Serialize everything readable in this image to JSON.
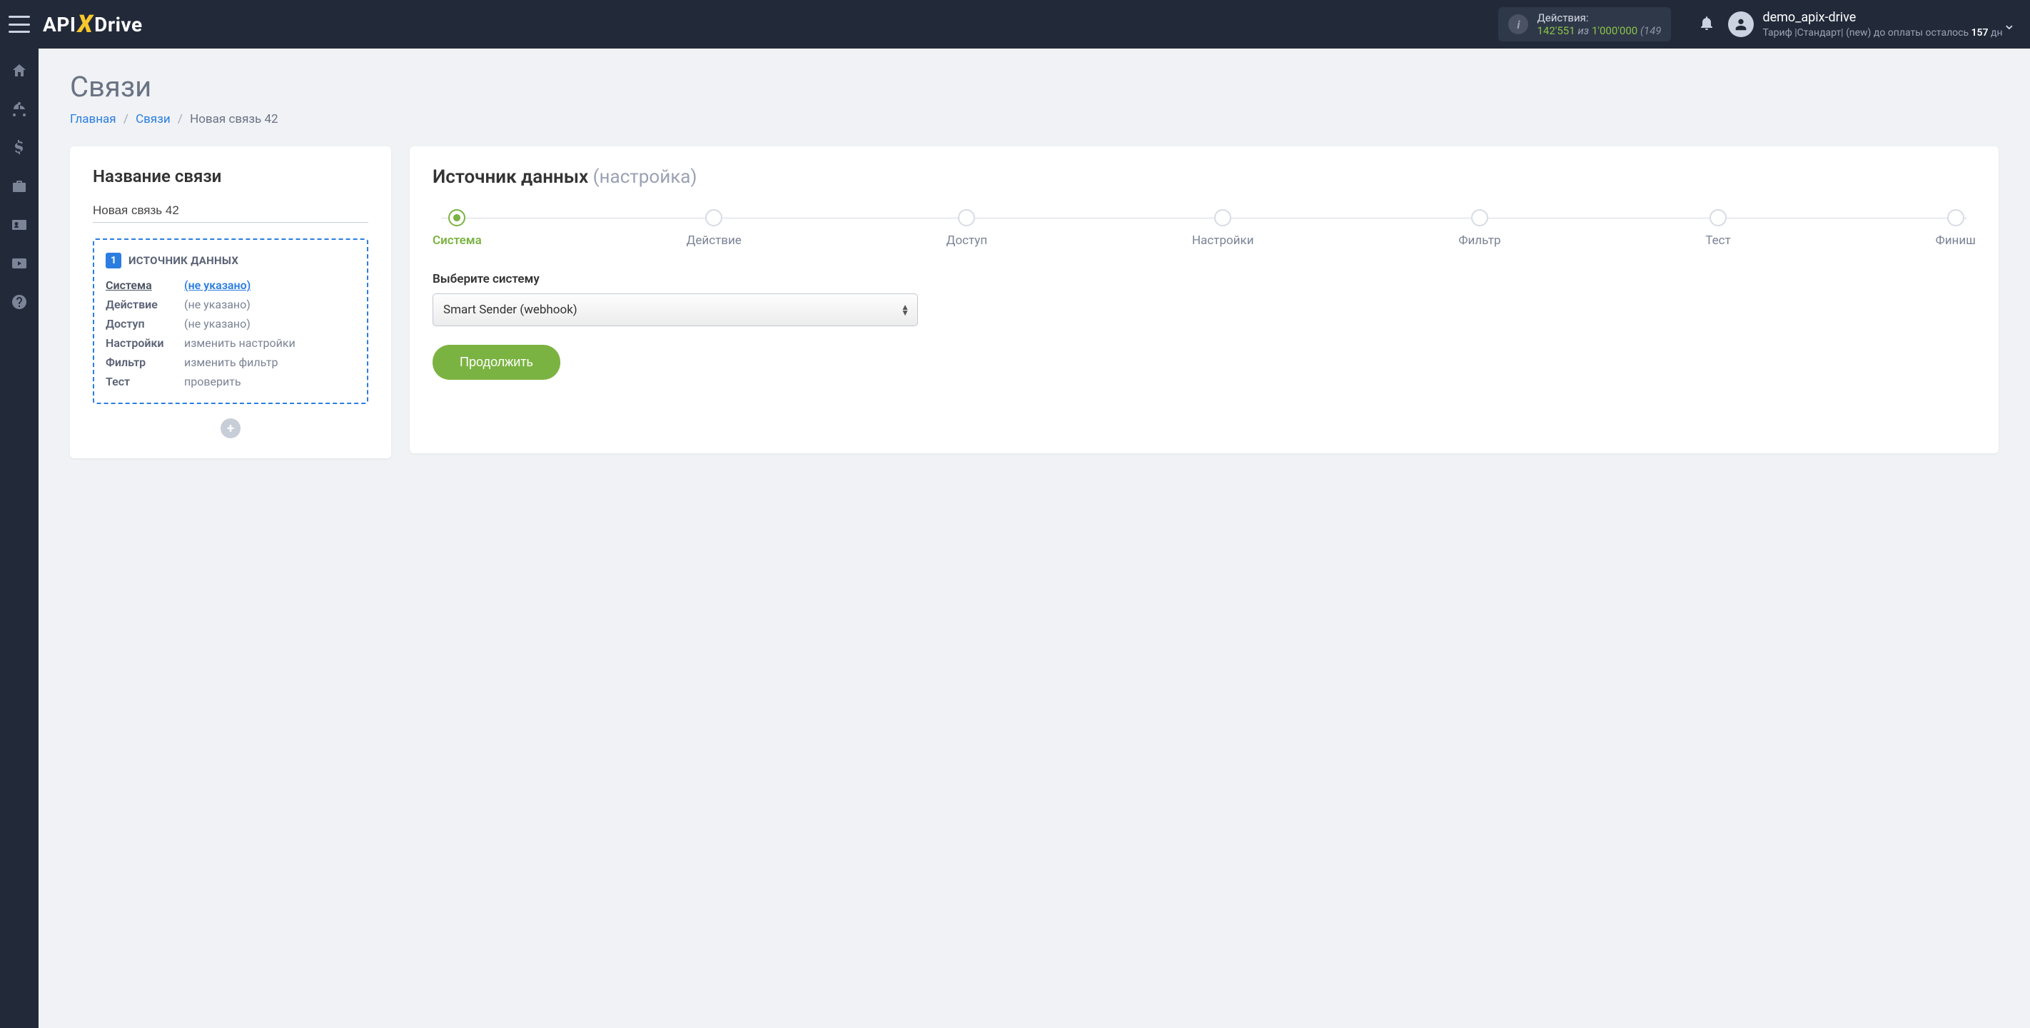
{
  "topbar": {
    "actions_label": "Действия:",
    "actions_count": "142'551",
    "actions_of": "из",
    "actions_total": "1'000'000",
    "actions_extra": "(149",
    "username": "demo_apix-drive",
    "tariff_prefix": "Тариф |Стандарт| (new) до оплаты осталось ",
    "tariff_days": "157",
    "tariff_suffix": " дн"
  },
  "page": {
    "title": "Связи",
    "crumb_home": "Главная",
    "crumb_links": "Связи",
    "crumb_current": "Новая связь 42"
  },
  "leftcard": {
    "heading": "Название связи",
    "conn_name": "Новая связь 42",
    "block_num": "1",
    "block_title": "ИСТОЧНИК ДАННЫХ",
    "rows": {
      "system_k": "Система",
      "system_v": "(не указано)",
      "action_k": "Действие",
      "action_v": "(не указано)",
      "access_k": "Доступ",
      "access_v": "(не указано)",
      "settings_k": "Настройки",
      "settings_v": "изменить настройки",
      "filter_k": "Фильтр",
      "filter_v": "изменить фильтр",
      "test_k": "Тест",
      "test_v": "проверить"
    }
  },
  "rightcard": {
    "heading_main": "Источник данных",
    "heading_sub": "(настройка)",
    "steps": {
      "system": "Система",
      "action": "Действие",
      "access": "Доступ",
      "settings": "Настройки",
      "filter": "Фильтр",
      "test": "Тест",
      "finish": "Финиш"
    },
    "select_label": "Выберите систему",
    "select_value": "Smart Sender (webhook)",
    "continue": "Продолжить"
  }
}
